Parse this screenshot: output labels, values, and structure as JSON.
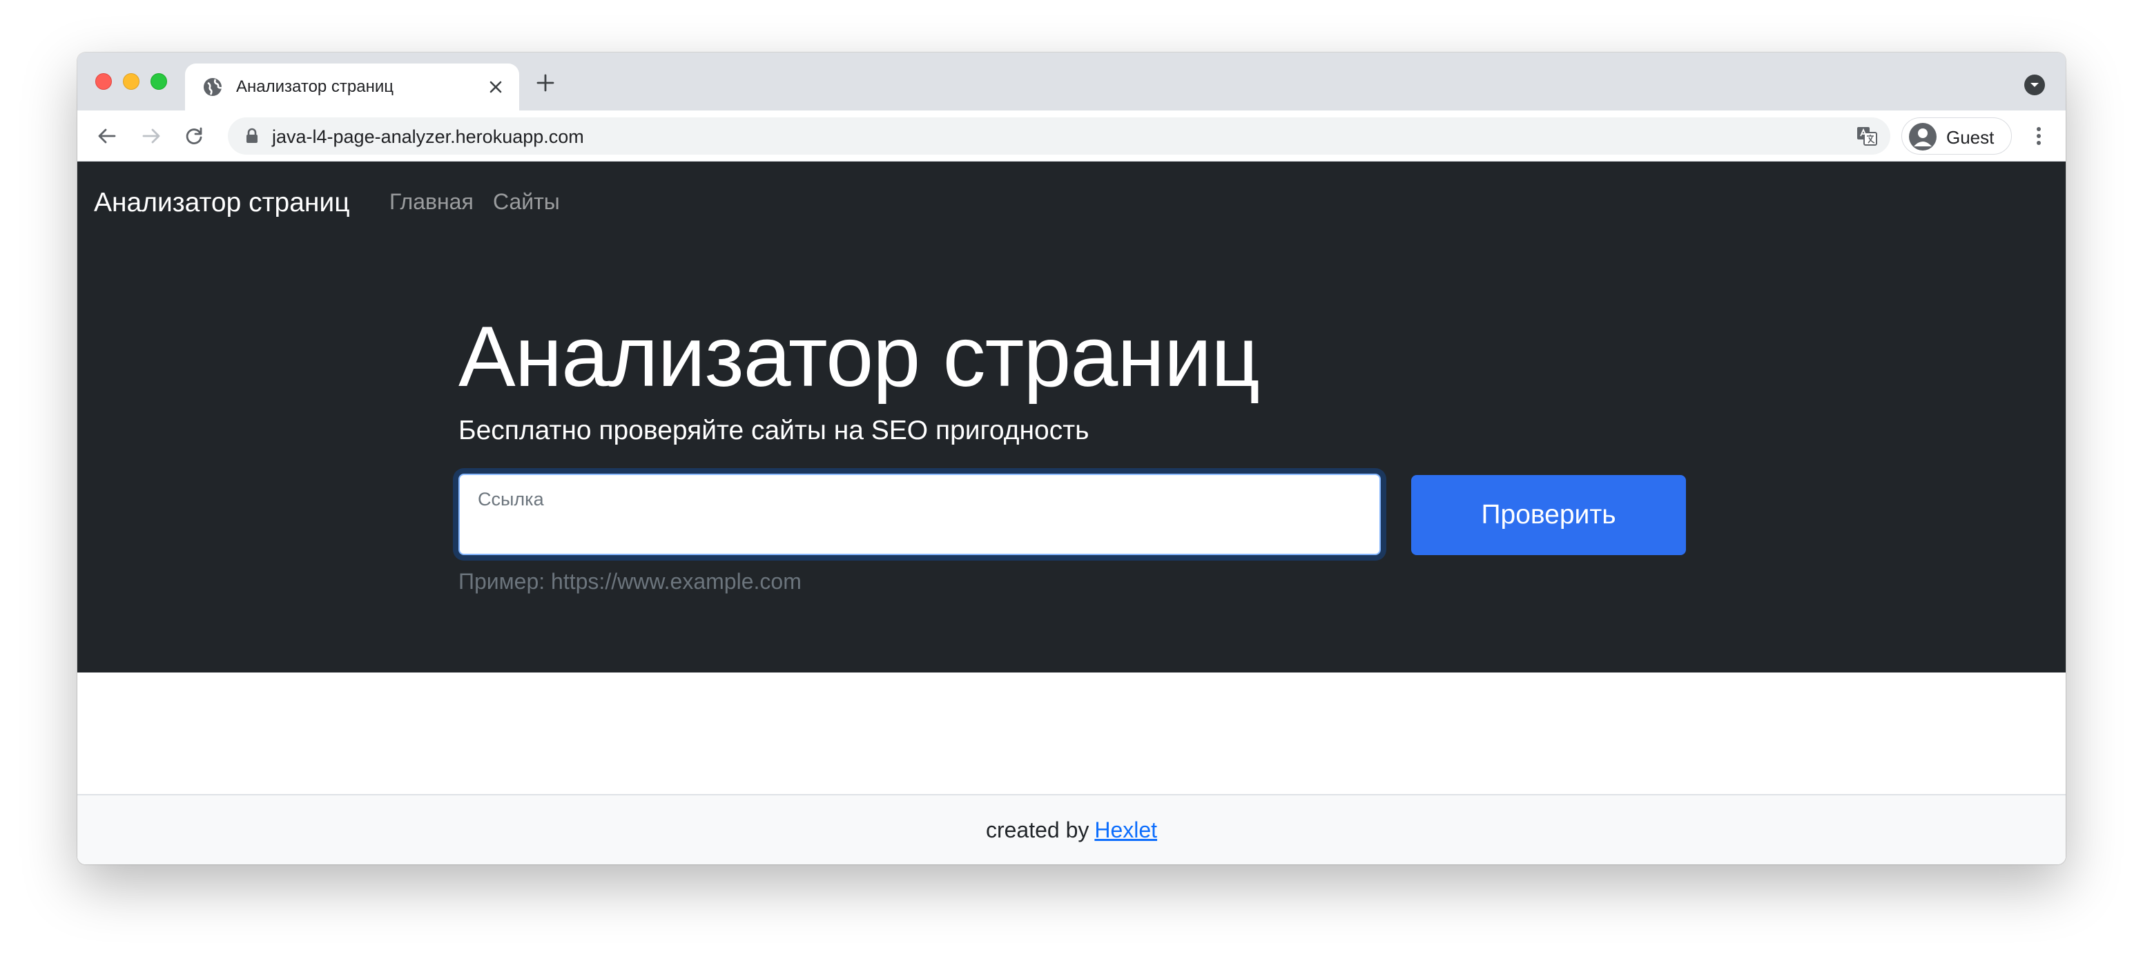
{
  "browser": {
    "tab": {
      "title": "Анализатор страниц",
      "favicon": "globe-icon"
    },
    "address_bar": {
      "url": "java-l4-page-analyzer.herokuapp.com"
    },
    "profile": {
      "label": "Guest"
    }
  },
  "navbar": {
    "brand": "Анализатор страниц",
    "links": [
      "Главная",
      "Сайты"
    ]
  },
  "hero": {
    "title": "Анализатор страниц",
    "lead": "Бесплатно проверяйте сайты на SEO пригодность",
    "url_field": {
      "label": "Ссылка",
      "value": ""
    },
    "submit_label": "Проверить",
    "hint": "Пример: https://www.example.com"
  },
  "footer": {
    "prefix": "created by",
    "link_text": "Hexlet"
  },
  "colors": {
    "hero_background": "#212529",
    "primary_button": "#2d6ff0",
    "link": "#0d6efd"
  }
}
